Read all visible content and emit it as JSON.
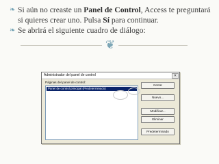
{
  "bullets": [
    {
      "segments": [
        {
          "text": "Si aún no creaste un ",
          "bold": false
        },
        {
          "text": "Panel de Control",
          "bold": true
        },
        {
          "text": ", Access te preguntará si quieres crear uno. Pulsa ",
          "bold": false
        },
        {
          "text": "Sí",
          "bold": true
        },
        {
          "text": " para continuar.",
          "bold": false
        }
      ]
    },
    {
      "segments": [
        {
          "text": "Se abrirá el siguiente cuadro de diálogo:",
          "bold": false
        }
      ]
    }
  ],
  "dialog": {
    "title": "Administrador del panel de control",
    "list_label": "Páginas del panel de control:",
    "list_items": [
      "Panel de control principal (Predeterminado)"
    ],
    "buttons": {
      "close": "Cerrar",
      "new": "Nuevo...",
      "modify": "Modificar...",
      "delete": "Eliminar",
      "default": "Predeterminado"
    }
  },
  "icons": {
    "bullet": "curly-bullet-icon",
    "divider_ornament": "ornament-icon",
    "title_close": "close-icon"
  },
  "colors": {
    "accent": "#6e9fb2",
    "dialog_bg": "#ece9d8",
    "selection": "#0a246a"
  }
}
